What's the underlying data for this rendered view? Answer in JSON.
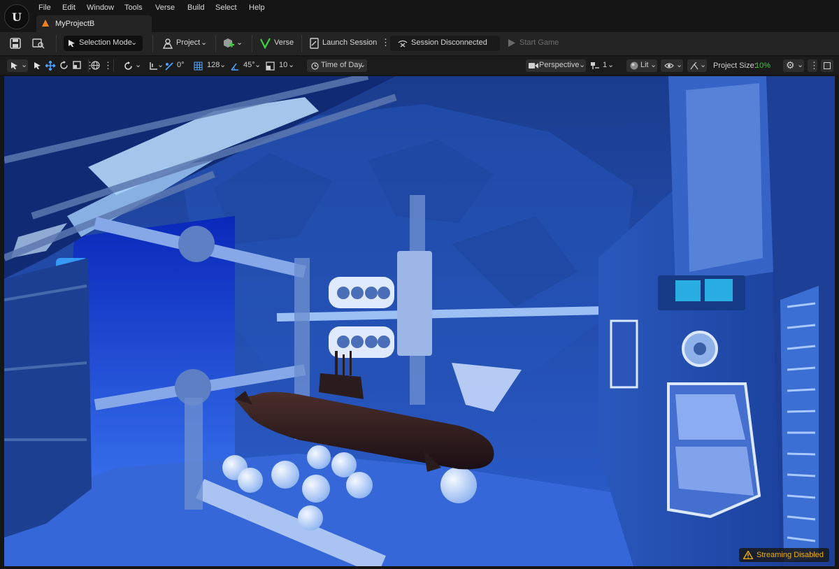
{
  "menu": [
    "File",
    "Edit",
    "Window",
    "Tools",
    "Verse",
    "Build",
    "Select",
    "Help"
  ],
  "tab": {
    "title": "MyProjectB"
  },
  "toolbar": {
    "selection_mode": "Selection Mode",
    "project": "Project",
    "verse": "Verse",
    "launch_session": "Launch Session",
    "session_status": "Session Disconnected",
    "start_game": "Start Game"
  },
  "viewport_toolbar": {
    "rotation_snap": "0°",
    "grid_size": "128",
    "angle_snap": "45°",
    "scale_snap": "10",
    "time_of_day": "Time of Day",
    "view_mode": "Perspective",
    "camera_speed": "1",
    "lighting": "Lit",
    "project_size_label": "Project Size:",
    "project_size_value": "10%"
  },
  "viewport": {
    "streaming_status": "Streaming Disabled"
  },
  "colors": {
    "accent_green": "#2fd12f",
    "warning": "#f0b000",
    "ue_orange": "#f08020"
  },
  "icons": [
    "save-icon",
    "content-browser-icon",
    "selection-mode-icon",
    "project-icon",
    "add-actor-icon",
    "verse-icon",
    "launch-session-icon",
    "session-disconnected-icon",
    "play-icon",
    "transform-icon",
    "select-arrow-icon",
    "move-icon",
    "rotate-icon",
    "scale-icon",
    "more-icon",
    "world-icon",
    "rotation-snap-icon",
    "surface-snap-icon",
    "grid-icon",
    "angle-icon",
    "scale-snap-icon",
    "time-of-day-icon",
    "camera-icon",
    "camera-speed-icon",
    "lit-sphere-icon",
    "eye-icon",
    "gizmo-icon",
    "settings-gear-icon",
    "warning-icon"
  ]
}
